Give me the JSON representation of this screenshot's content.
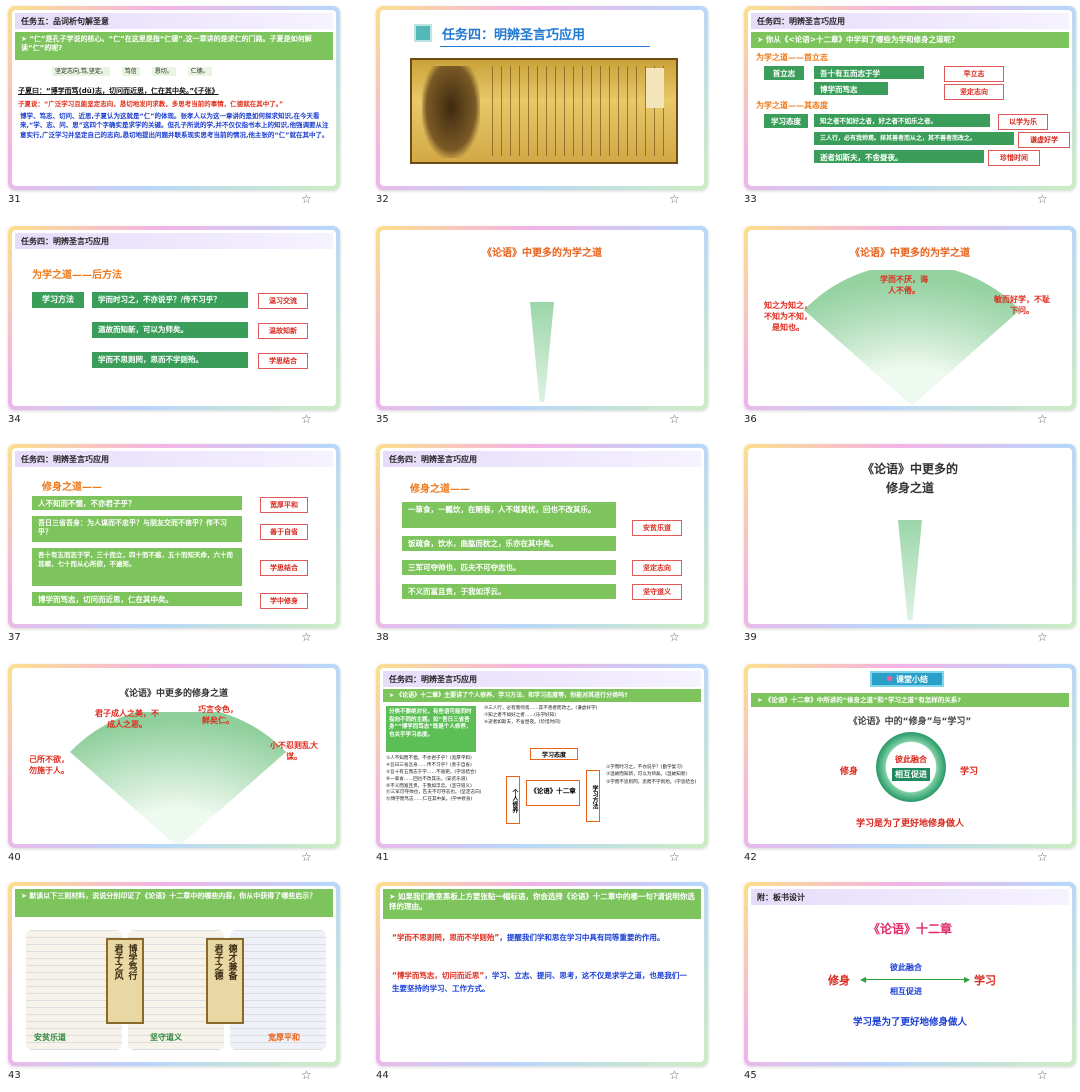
{
  "slides": {
    "s31": {
      "number": "31",
      "header": "任务五：品词析句解圣意",
      "q": "“仁”是孔子学说的核心。“仁”在这里是指“仁德”,这一章讲的是求仁的门路。子夏是如何解读“仁”的呢?",
      "chips": [
        "坚定志向,笃,坚定。",
        "笃信",
        "恳切。",
        "仁德。"
      ],
      "quote": "子夏曰：“博学而笃(dǔ)志，切问而近思，仁在其中矣。”《子张》",
      "trans": "子夏说：“广泛学习且能坚定志向，恳切地发问求教，多思考当前的事情，仁德就在其中了。”",
      "para": "博学、笃志、切问、近思,子夏认为这就是“仁”的体现。张孝人以为这一章讲的是如何探求知识,在今天看来,“学、志、问、思”这四个字确实是求学的关键。但孔子所说的学,并不仅仅指书本上的知识,他强调要从注意实行,广泛学习并坚定自己的志向,恳切地提出问题并联系现实思考当前的情况,他主张的“仁”就在其中了。"
    },
    "s32": {
      "number": "32",
      "title": "任务四：明辨圣言巧应用"
    },
    "s33": {
      "number": "33",
      "header": "任务四：明辨圣言巧应用",
      "q": "你从《<论语>十二章》中学到了哪些为学和修身之道呢?",
      "sec1": "为学之道——首立志",
      "label1": "首立志",
      "rows1": [
        {
          "text": "吾十有五而志于学",
          "tag": "早立志"
        },
        {
          "text": "博学而笃志",
          "tag": "坚定志向"
        }
      ],
      "sec2": "为学之道——其态度",
      "label2": "学习态度",
      "rows2": [
        {
          "text": "知之者不如好之者，好之者不如乐之者。",
          "tag": "以学为乐"
        },
        {
          "text": "三人行，必有我师焉。择其善者而从之，其不善者而改之。",
          "tag": "谦虚好学"
        },
        {
          "text": "逝者如斯夫，不舍昼夜。",
          "tag": "珍惜时间"
        }
      ]
    },
    "s34": {
      "number": "34",
      "header": "任务四：明辨圣言巧应用",
      "sec": "为学之道——后方法",
      "label": "学习方法",
      "rows": [
        {
          "text": "学而时习之，不亦说乎？/传不习乎？",
          "tag": "温习交流"
        },
        {
          "text": "温故而知新，可以为师矣。",
          "tag": "温故知新"
        },
        {
          "text": "学而不思则罔，思而不学则殆。",
          "tag": "学思结合"
        }
      ]
    },
    "s35": {
      "number": "35",
      "title": "《论语》中更多的为学之道"
    },
    "s36": {
      "number": "36",
      "title": "《论语》中更多的为学之道",
      "left": "知之为知之，不知为不知，是知也。",
      "top": "学而不厌，诲人不倦。",
      "right": "敏而好学，不耻下问。"
    },
    "s37": {
      "number": "37",
      "header": "任务四：明辨圣言巧应用",
      "sec": "修身之道——",
      "rows": [
        {
          "text": "人不知而不愠，不亦君子乎？",
          "tag": "宽厚平和"
        },
        {
          "text": "吾日三省吾身：为人谋而不忠乎？与朋友交而不信乎？传不习乎？",
          "tag": "善于自省"
        },
        {
          "text": "吾十有五而志于学，三十而立，四十而不惑，五十而知天命，六十而耳顺，七十而从心所欲，不逾矩。",
          "tag": "学思结合"
        },
        {
          "text": "博学而笃志，切问而近思，仁在其中矣。",
          "tag": "学中修身"
        }
      ]
    },
    "s38": {
      "number": "38",
      "header": "任务四：明辨圣言巧应用",
      "sec": "修身之道——",
      "rows": [
        {
          "text": "一箪食，一瓢饮，在陋巷，人不堪其忧，回也不改其乐。",
          "tag": "安贫乐道"
        },
        {
          "text": "饭疏食，饮水，曲肱而枕之，乐亦在其中矣。",
          "tag": ""
        },
        {
          "text": "三军可夺帅也，匹夫不可夺志也。",
          "tag": "坚定志向"
        },
        {
          "text": "不义而富且贵，于我如浮云。",
          "tag": "坚守道义"
        }
      ]
    },
    "s39": {
      "number": "39",
      "title1": "《论语》中更多的",
      "title2": "修身之道"
    },
    "s40": {
      "number": "40",
      "title": "《论语》中更多的修身之道",
      "l1": "君子成人之美，不成人之恶。",
      "l2": "巧言令色，鲜矣仁。",
      "l3": "己所不欲，勿施于人。",
      "l4": "小不忍则乱大谋。"
    },
    "s41": {
      "number": "41",
      "header": "任务四：明辨圣言巧应用",
      "q": "《论语》十二章》主要讲了个人修养、学习方法、和学习态度等，你能对其进行分类吗?",
      "note": "分类不要绝对化，有些语可能同时指向不同的主题。如“吾日三省吾身”“博学而笃志”既是个人修养，也关乎学习态度。",
      "center": "《论语》十二章",
      "left_box": "个人修养",
      "top_box": "学习态度",
      "right_box": "学习方法",
      "leftList": [
        "①人不知而不愠，不亦君子乎？(宽厚平和)",
        "④吾日三省吾身……传不习乎？(善于自省)",
        "⑤吾十有五而志于学……不逾矩。(学思结合)",
        "⑧一箪食……回也不改其乐。(安贫乐道)",
        "⑨不义而富且贵，于我如浮云。(坚守道义)",
        "⑪三军可夺帅也，匹夫不可夺志也。(坚定志向)",
        "⑫博学而笃志……仁在其中矣。(学中修身)"
      ],
      "topList": [
        "⑩三人行，必有我师焉……其不善者而改之。(谦虚好学)",
        "⑦知之者不如好之者……(乐学好知)",
        "⑥逝者如斯夫，不舍昼夜。(珍惜时间)"
      ],
      "rightList": [
        "①学而时习之，不亦说乎？(勤学复习)",
        "③温故而知新，可以为师矣。(温故知新)",
        "②学而不思则罔，思而不学则殆。(学思结合)"
      ]
    },
    "s42": {
      "number": "42",
      "badge": "课堂小结",
      "q": "《论语》十二章》中所讲的“修身之道”和“学习之道”有怎样的关系?",
      "title": "《论语》中的“修身”与“学习”",
      "left": "修身",
      "right": "学习",
      "c1": "彼此融合",
      "c2": "相互促进",
      "bottom": "学习是为了更好地修身做人"
    },
    "s43": {
      "number": "43",
      "q": "默读以下三则材料，说说分别印证了《论语》十二章中的哪些内容，你从中获得了哪些启示？",
      "scroll1": "君子之风",
      "scroll1b": "博学笃行",
      "scroll2": "君子之德",
      "scroll2b": "德才兼备",
      "captions": [
        "安贫乐道",
        "坚守道义",
        "宽厚平和"
      ]
    },
    "s44": {
      "number": "44",
      "q": "如果我们教室黑板上方要张贴一幅标语，你会选择《论语》十二章中的哪一句?请说明你选择的理由。",
      "p1a": "“学而不思则罔，思而不学则殆”",
      "p1b": "，提醒我们学和思在学习中具有同等重要的作用。",
      "p2a": "“博学而笃志，切问而近思”",
      "p2b": "，学习、立志、提问、思考，这不仅是求学之道，也是我们一生要坚持的学习、工作方式。"
    },
    "s45": {
      "number": "45",
      "header": "附：板书设计",
      "title": "《论语》十二章",
      "left": "修身",
      "right": "学习",
      "a1": "彼此融合",
      "a2": "相互促进",
      "bottom": "学习是为了更好地修身做人"
    }
  },
  "ui": {
    "star_icon": "☆"
  }
}
